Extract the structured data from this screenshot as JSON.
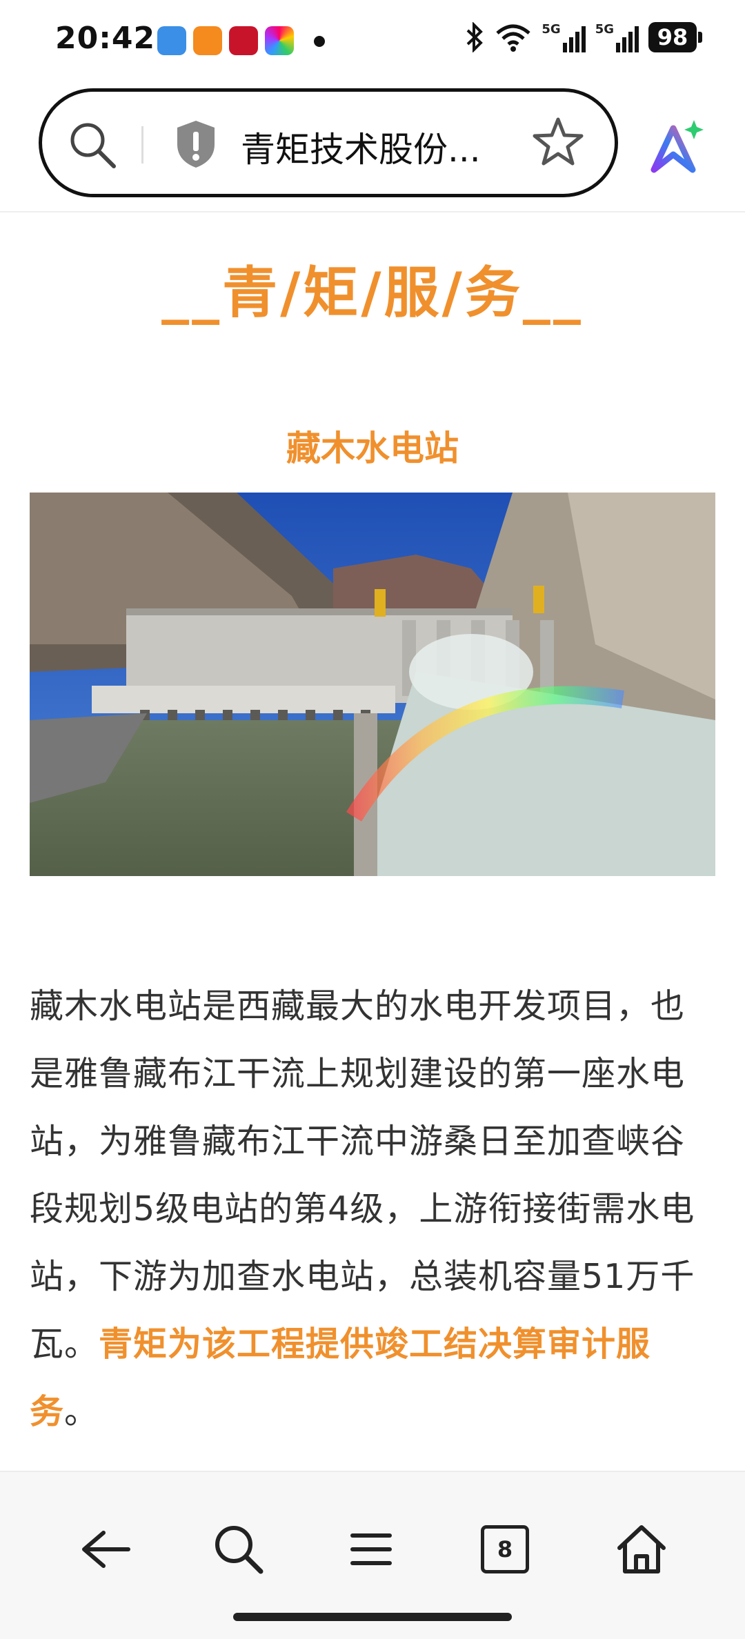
{
  "status": {
    "time": "20:42",
    "battery": "98",
    "signal1": "5G",
    "signal2": "5G"
  },
  "browser": {
    "address_text": "青矩技术股份...",
    "tab_count": "8"
  },
  "content": {
    "section_title": "__青/矩/服/务__",
    "project_title": "藏木水电站",
    "paragraph_plain": "藏木水电站是西藏最大的水电开发项目，也是雅鲁藏布江干流上规划建设的第一座水电站，为雅鲁藏布江干流中游桑日至加查峡谷段规划5级电站的第4级，上游衔接街需水电站，下游为加查水电站，总装机容量51万千瓦。",
    "paragraph_highlight": "青矩为该工程提供竣工结决算审计服务",
    "paragraph_end": "。"
  },
  "colors": {
    "accent": "#F0902D"
  }
}
